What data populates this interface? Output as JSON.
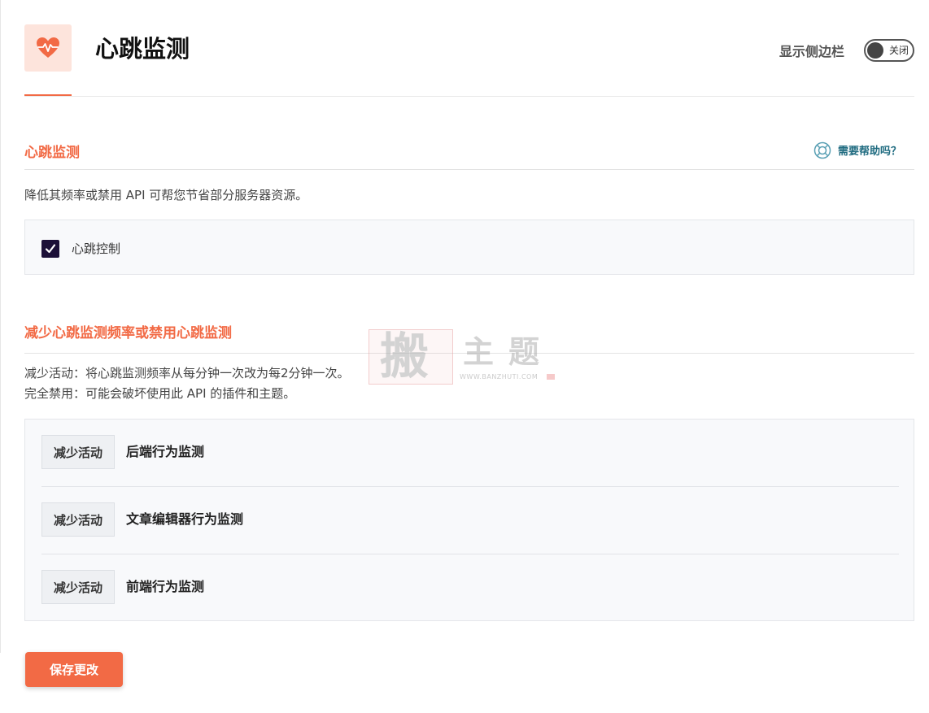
{
  "header": {
    "title": "心跳监测",
    "sidebar_label": "显示侧边栏",
    "sidebar_toggle": {
      "state_label": "关闭",
      "on": false
    },
    "icon": "heart-pulse-icon"
  },
  "heartbeat_section": {
    "title": "心跳监测",
    "help_label": "需要帮助吗？",
    "help_icon": "lifebuoy-icon",
    "description": "降低其频率或禁用 API 可帮您节省部分服务器资源。",
    "control": {
      "label": "心跳控制",
      "checked": true
    }
  },
  "frequency_section": {
    "title": "减少心跳监测频率或禁用心跳监测",
    "description_lines": [
      "减少活动：将心跳监测频率从每分钟一次改为每2分钟一次。",
      "完全禁用：可能会破坏使用此 API 的插件和主题。"
    ],
    "rows": [
      {
        "selected": "减少活动",
        "label": "后端行为监测"
      },
      {
        "selected": "减少活动",
        "label": "文章编辑器行为监测"
      },
      {
        "selected": "减少活动",
        "label": "前端行为监测"
      }
    ]
  },
  "watermark": {
    "chars": [
      "搬",
      "主",
      "题"
    ],
    "url": "WWW.BANZHUTI.COM"
  },
  "save_label": "保存更改",
  "colors": {
    "accent": "#f26a45",
    "help": "#1f6b80",
    "checkbox": "#1c1038"
  }
}
